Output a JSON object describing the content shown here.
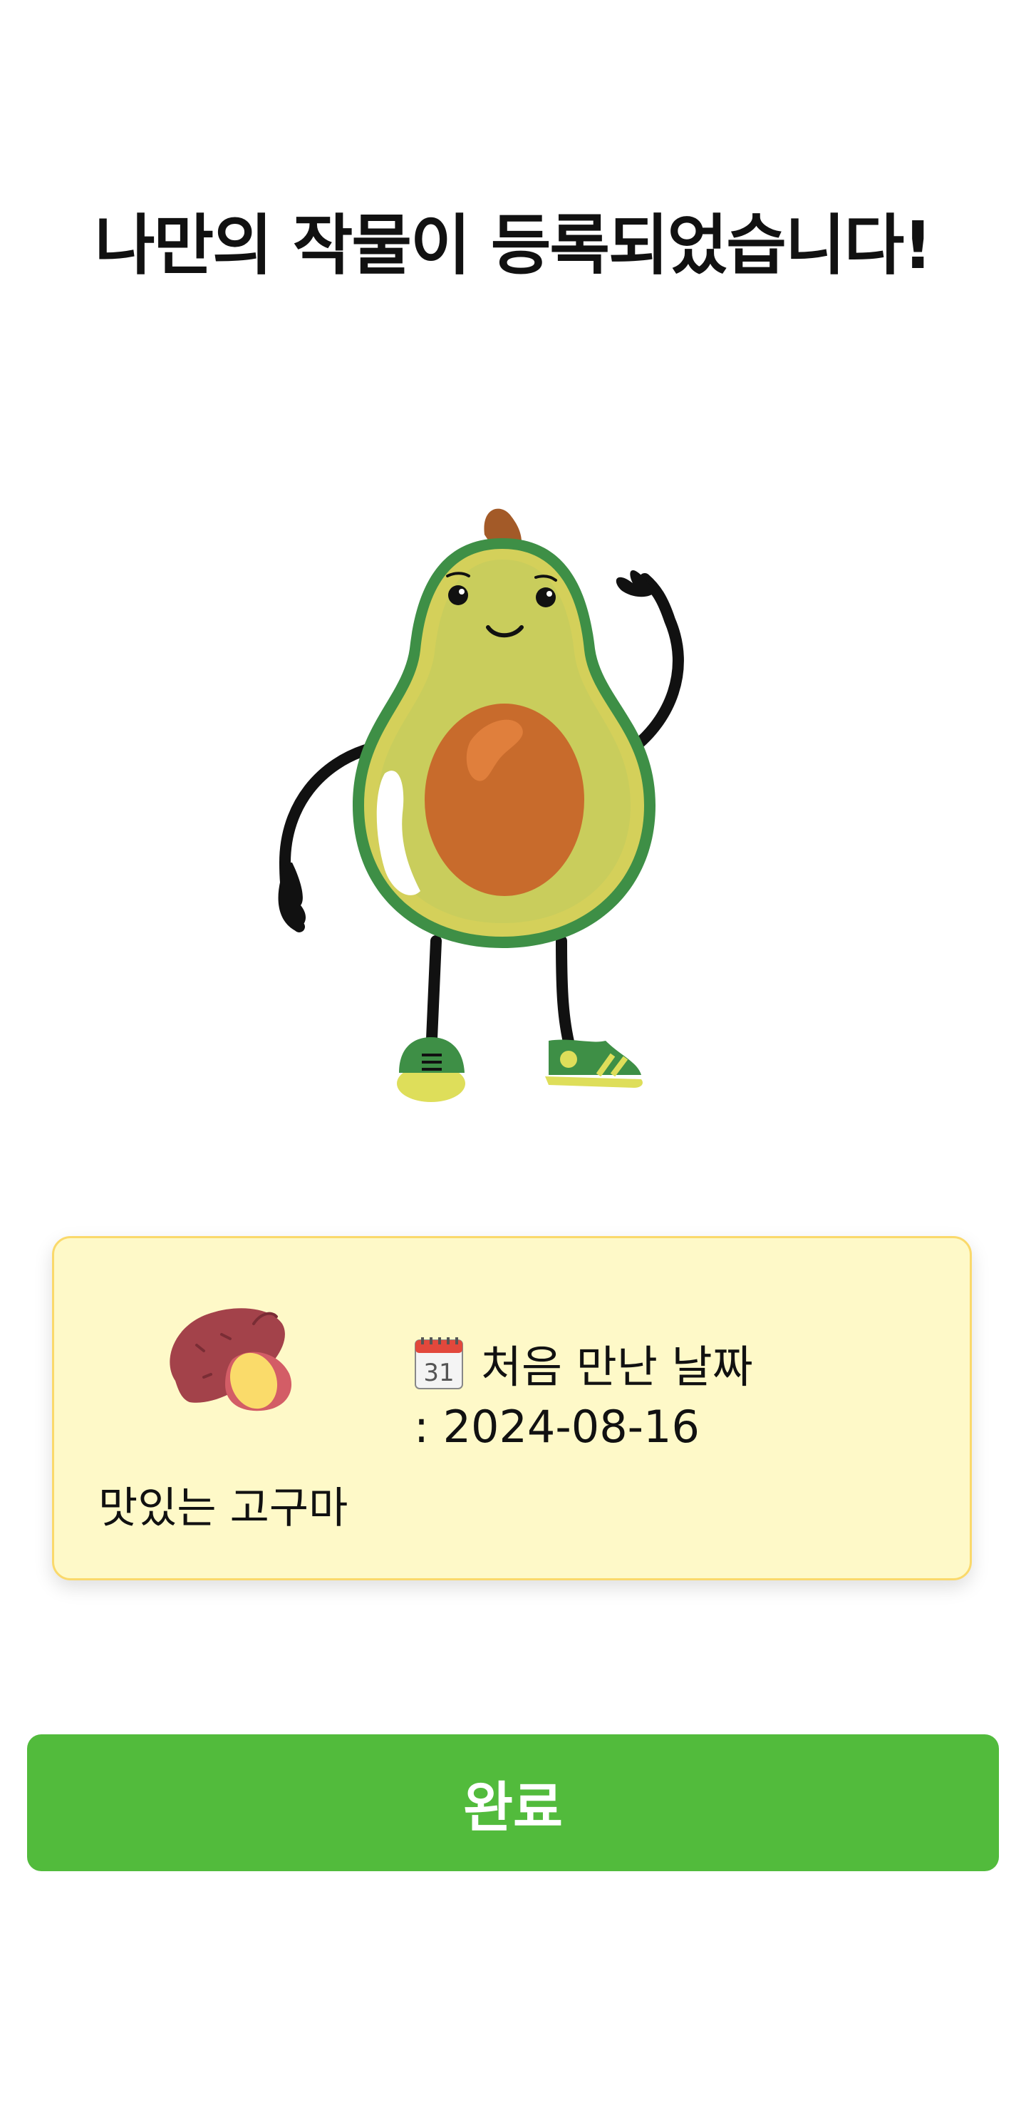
{
  "header": {
    "title": "나만의 작물이 등록되었습니다!"
  },
  "mascot": {
    "icon": "avocado-character"
  },
  "crop_card": {
    "crop_icon": "sweet-potato-icon",
    "crop_name": "맛있는 고구마",
    "date_icon": "calendar-icon",
    "date_label": "처음 만난 날짜",
    "date_value": ": 2024-08-16"
  },
  "actions": {
    "done_label": "완료"
  },
  "colors": {
    "primary_button": "#52bb3c",
    "card_background": "#fef9c8",
    "card_border": "#fad96b"
  }
}
